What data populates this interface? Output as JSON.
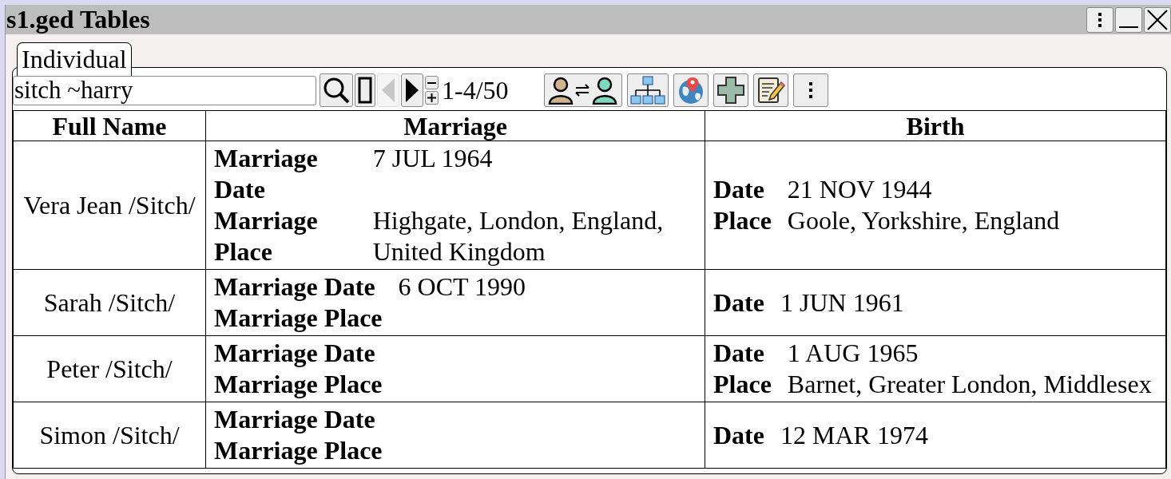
{
  "window": {
    "title": "s1.ged Tables"
  },
  "tabs": [
    {
      "label": "Individual",
      "selected": true
    }
  ],
  "search": {
    "value": "sitch ~harry"
  },
  "pager": {
    "previous": {
      "disabled": true
    },
    "next": {
      "disabled": false
    },
    "range": "1-4/50"
  },
  "table": {
    "columns": [
      "Full Name",
      "Marriage",
      "Birth"
    ],
    "rows": [
      {
        "full_name": "Vera Jean /Sitch/",
        "marriage": [
          {
            "label": "Marriage Date",
            "value": "7 JUL 1964"
          },
          {
            "label": "Marriage Place",
            "value": "Highgate, London, England, United Kingdom"
          }
        ],
        "birth": [
          {
            "label": "Date",
            "value": "21 NOV 1944"
          },
          {
            "label": "Place",
            "value": "Goole, Yorkshire, England"
          }
        ]
      },
      {
        "full_name": "Sarah /Sitch/",
        "marriage": [
          {
            "label": "Marriage Date",
            "value": "6 OCT 1990"
          },
          {
            "label": "Marriage Place"
          }
        ],
        "birth": [
          {
            "label": "Date",
            "value": "1 JUN 1961"
          }
        ]
      },
      {
        "full_name": "Peter /Sitch/",
        "marriage": [
          {
            "label": "Marriage Date"
          },
          {
            "label": "Marriage Place"
          }
        ],
        "birth": [
          {
            "label": "Date",
            "value": "1 AUG 1965"
          },
          {
            "label": "Place",
            "value": "Barnet, Greater London, Middlesex"
          }
        ]
      },
      {
        "full_name": "Simon /Sitch/",
        "marriage": [
          {
            "label": "Marriage Date"
          },
          {
            "label": "Marriage Place"
          }
        ],
        "birth": [
          {
            "label": "Date",
            "value": "12 MAR 1974"
          }
        ]
      }
    ]
  }
}
